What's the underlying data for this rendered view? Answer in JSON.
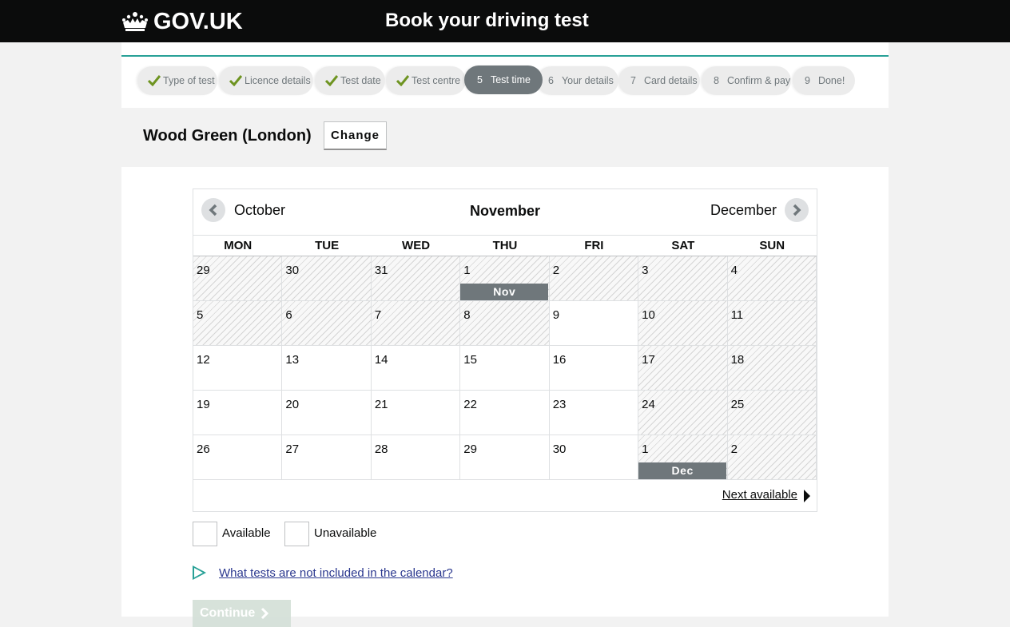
{
  "header": {
    "logo_text": "GOV.UK",
    "service_name": "Book your driving test"
  },
  "steps": [
    {
      "num": "",
      "label": "Type of test",
      "done": true
    },
    {
      "num": "",
      "label": "Licence details",
      "done": true
    },
    {
      "num": "",
      "label": "Test date",
      "done": true
    },
    {
      "num": "",
      "label": "Test centre",
      "done": true
    },
    {
      "num": "5",
      "label": "Test time",
      "current": true
    },
    {
      "num": "6",
      "label": "Your details"
    },
    {
      "num": "7",
      "label": "Card details"
    },
    {
      "num": "8",
      "label": "Confirm & pay"
    },
    {
      "num": "9",
      "label": "Done!"
    }
  ],
  "centre": {
    "name": "Wood Green (London)",
    "change_label": "Change"
  },
  "calendar": {
    "prev_month": "October",
    "current_month": "November",
    "next_month": "December",
    "days_of_week": [
      "MON",
      "TUE",
      "WED",
      "THU",
      "FRI",
      "SAT",
      "SUN"
    ],
    "weeks": [
      [
        {
          "d": "29",
          "available": false
        },
        {
          "d": "30",
          "available": false
        },
        {
          "d": "31",
          "available": false
        },
        {
          "d": "1",
          "available": false,
          "tag": "Nov"
        },
        {
          "d": "2",
          "available": false
        },
        {
          "d": "3",
          "available": false
        },
        {
          "d": "4",
          "available": false
        }
      ],
      [
        {
          "d": "5",
          "available": false
        },
        {
          "d": "6",
          "available": false
        },
        {
          "d": "7",
          "available": false
        },
        {
          "d": "8",
          "available": false
        },
        {
          "d": "9",
          "available": true
        },
        {
          "d": "10",
          "available": false
        },
        {
          "d": "11",
          "available": false
        }
      ],
      [
        {
          "d": "12",
          "available": true
        },
        {
          "d": "13",
          "available": true
        },
        {
          "d": "14",
          "available": true
        },
        {
          "d": "15",
          "available": true
        },
        {
          "d": "16",
          "available": true
        },
        {
          "d": "17",
          "available": false
        },
        {
          "d": "18",
          "available": false
        }
      ],
      [
        {
          "d": "19",
          "available": true
        },
        {
          "d": "20",
          "available": true
        },
        {
          "d": "21",
          "available": true
        },
        {
          "d": "22",
          "available": true
        },
        {
          "d": "23",
          "available": true
        },
        {
          "d": "24",
          "available": false
        },
        {
          "d": "25",
          "available": false
        }
      ],
      [
        {
          "d": "26",
          "available": true
        },
        {
          "d": "27",
          "available": true
        },
        {
          "d": "28",
          "available": true
        },
        {
          "d": "29",
          "available": true
        },
        {
          "d": "30",
          "available": true
        },
        {
          "d": "1",
          "available": false,
          "tag": "Dec"
        },
        {
          "d": "2",
          "available": false
        }
      ]
    ],
    "next_available_label": "Next available"
  },
  "legend": {
    "available_label": "Available",
    "unavailable_label": "Unavailable"
  },
  "details_link": "What tests are not included in the calendar?",
  "continue_label": "Continue",
  "colors": {
    "header_bg": "#0b0c0c",
    "accent": "#28a197",
    "check": "#6e9421",
    "current_step": "#6f777b",
    "link": "#2b388f",
    "continue_disabled": "#d5e1d9"
  }
}
